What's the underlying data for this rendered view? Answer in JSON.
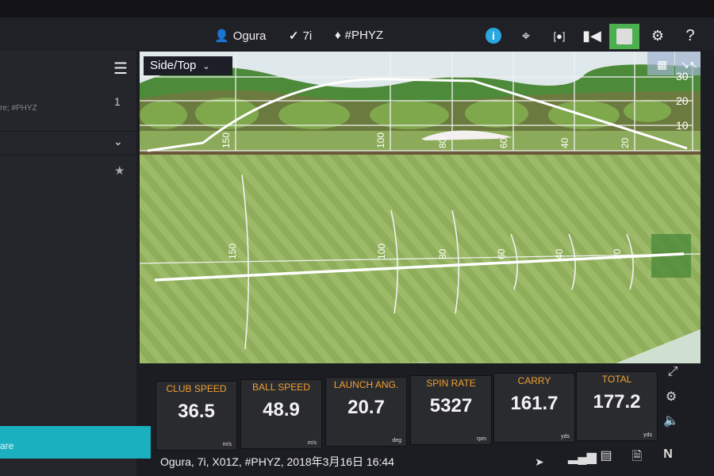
{
  "header": {
    "user": "Ogura",
    "club": "7i",
    "tag": "#PHYZ",
    "icons": [
      "user-icon",
      "club-icon",
      "tag-icon",
      "info-icon",
      "target-icon",
      "camera-frame-icon",
      "video-camera-icon",
      "panel-icon",
      "gear-icon",
      "help-icon"
    ],
    "accent": "#4caf50",
    "info_color": "#29a8e0"
  },
  "sidebar": {
    "item_text": "re; #PHYZ",
    "count": "1",
    "active_item": "are",
    "active_color": "#1ab0c0"
  },
  "view": {
    "mode": "Side/Top",
    "distance_labels": [
      "150",
      "100",
      "80",
      "60",
      "40",
      "20"
    ],
    "height_labels": [
      "30",
      "20",
      "10"
    ]
  },
  "metrics": [
    {
      "label": "CLUB SPEED",
      "value": "36.5",
      "unit": "m/s"
    },
    {
      "label": "BALL SPEED",
      "value": "48.9",
      "unit": "m/s"
    },
    {
      "label": "LAUNCH ANG.",
      "value": "20.7",
      "unit": "deg"
    },
    {
      "label": "SPIN RATE",
      "value": "5327",
      "unit": "rpm"
    },
    {
      "label": "CARRY",
      "value": "161.7",
      "unit": "yds"
    },
    {
      "label": "TOTAL",
      "value": "177.2",
      "unit": "yds"
    }
  ],
  "status": {
    "text": "Ogura, 7i, X01Z, #PHYZ, 2018年3月16日 16:44",
    "shortcut": "N"
  }
}
